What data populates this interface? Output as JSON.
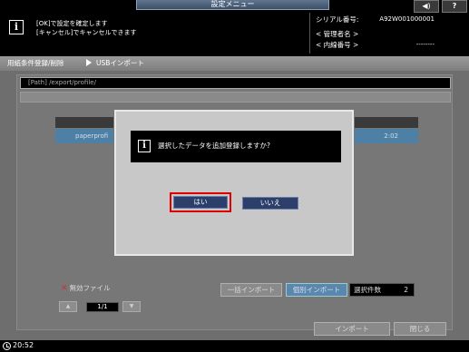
{
  "header": {
    "title": "設定メニュー",
    "message_line1": "[OK]で設定を確定します",
    "message_line2": "[キャンセル]でキャンセルできます",
    "serial_label": "シリアル番号:",
    "serial_value": "A92W001000001",
    "admin_label": "< 管理者名 >",
    "line_label": "< 内線番号 >",
    "line_value": "--------",
    "speaker_symbol": "◀)",
    "help_label": "?"
  },
  "breadcrumb": {
    "item1": "用紙条件登録/削除",
    "item2": "USBインポート"
  },
  "main": {
    "path": "[Path] /export/profile/",
    "row_left": "paperprofi",
    "row_right": "2:02",
    "invalid_label": "無効ファイル",
    "invalid_mark": "✕",
    "pager_up": "▲",
    "pager_down": "▼",
    "pager_text": "1/1",
    "bulk_import": "一括インポート",
    "individual_import": "個別インポート",
    "selected_count_label": "選択件数",
    "selected_count_value": "2",
    "import_button": "インポート",
    "close_button": "閉じる"
  },
  "dialog": {
    "icon": "i",
    "message": "選択したデータを追加登録しますか?",
    "yes": "はい",
    "no": "いいえ"
  },
  "status": {
    "time": "20:52"
  }
}
